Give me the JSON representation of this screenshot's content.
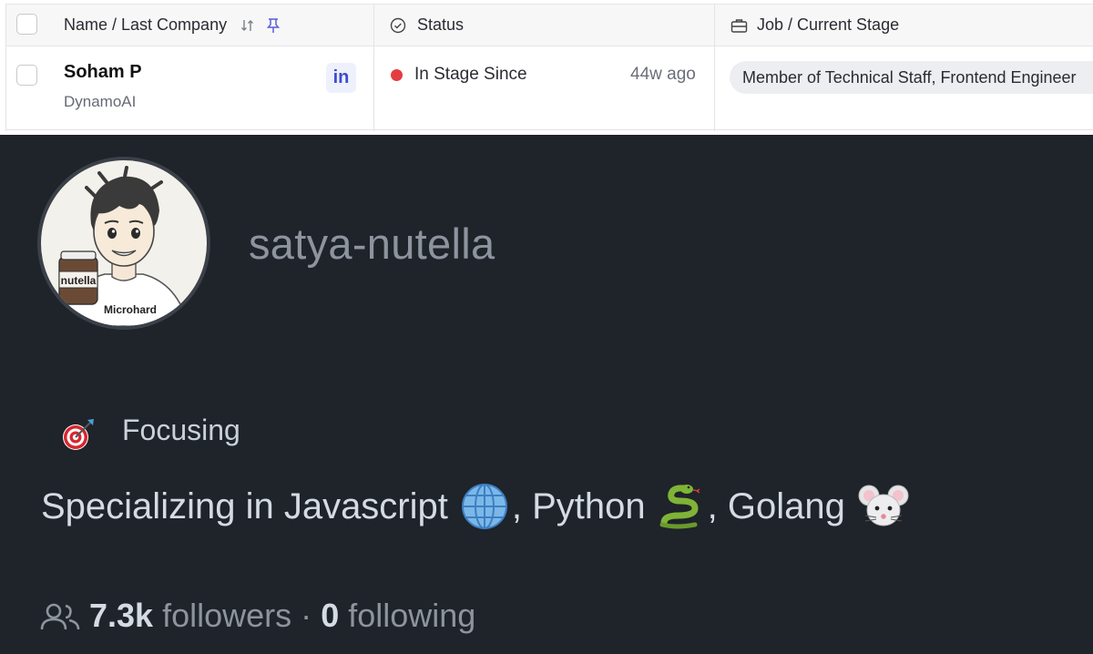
{
  "table": {
    "columns": {
      "name": "Name / Last Company",
      "status": "Status",
      "job": "Job / Current Stage"
    },
    "row": {
      "name": "Soham P",
      "company": "DynamoAI",
      "linkedin": "in",
      "status": "In Stage Since",
      "status_color": "#e43d40",
      "age": "44w ago",
      "job": "Member of Technical Staff, Frontend Engineer"
    }
  },
  "profile": {
    "username": "satya-nutella",
    "avatar_labels": {
      "jar": "nutella",
      "shirt": "Microhard"
    },
    "status_emoji": "dart-icon",
    "status_text": "Focusing",
    "bio": {
      "prefix": "Specializing in Javascript",
      "sep1": ", Python",
      "sep2": ", Golang"
    },
    "followers_count": "7.3k",
    "followers_label": "followers",
    "dot": "·",
    "following_count": "0",
    "following_label": "following"
  }
}
